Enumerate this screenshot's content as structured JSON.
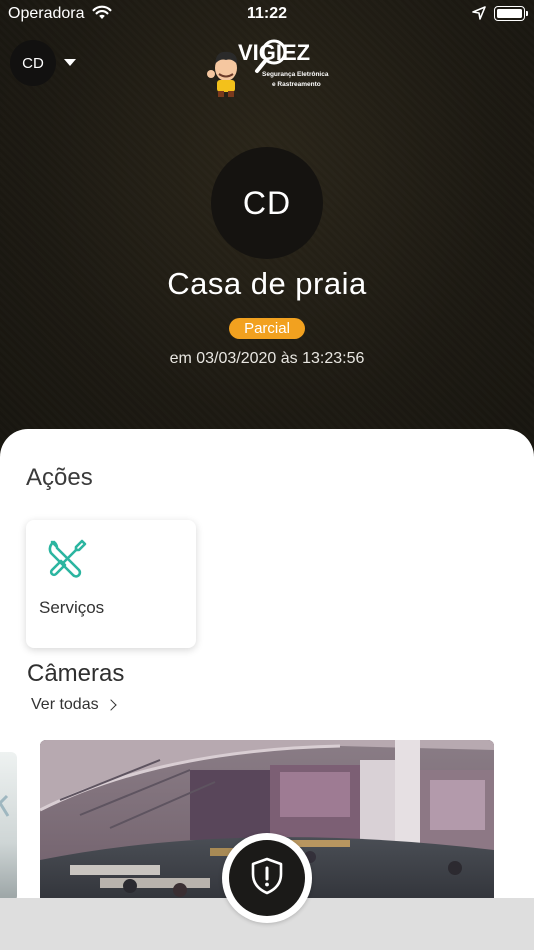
{
  "status_bar": {
    "carrier": "Operadora",
    "time": "11:22",
    "icons": [
      "wifi-icon",
      "location-arrow-icon",
      "battery-icon"
    ]
  },
  "header": {
    "account_initials": "CD",
    "logo": {
      "brand_text": "VIGIEZ",
      "tagline_line1": "Segurança Eletrônica",
      "tagline_line2": "e Rastreamento"
    }
  },
  "place": {
    "initials": "CD",
    "name": "Casa de praia",
    "status": "Parcial",
    "status_color": "#f2a11f",
    "updated": "em 03/03/2020 às 13:23:56"
  },
  "actions": {
    "title": "Ações",
    "items": [
      {
        "label": "Serviços",
        "icon": "tools-icon",
        "icon_color": "#2bb5a0"
      }
    ]
  },
  "cameras": {
    "title": "Câmeras",
    "see_all": "Ver todas",
    "feeds": [
      "camera-feed-partial",
      "camera-feed-office"
    ]
  },
  "fab": {
    "icon": "shield-alert-icon"
  }
}
